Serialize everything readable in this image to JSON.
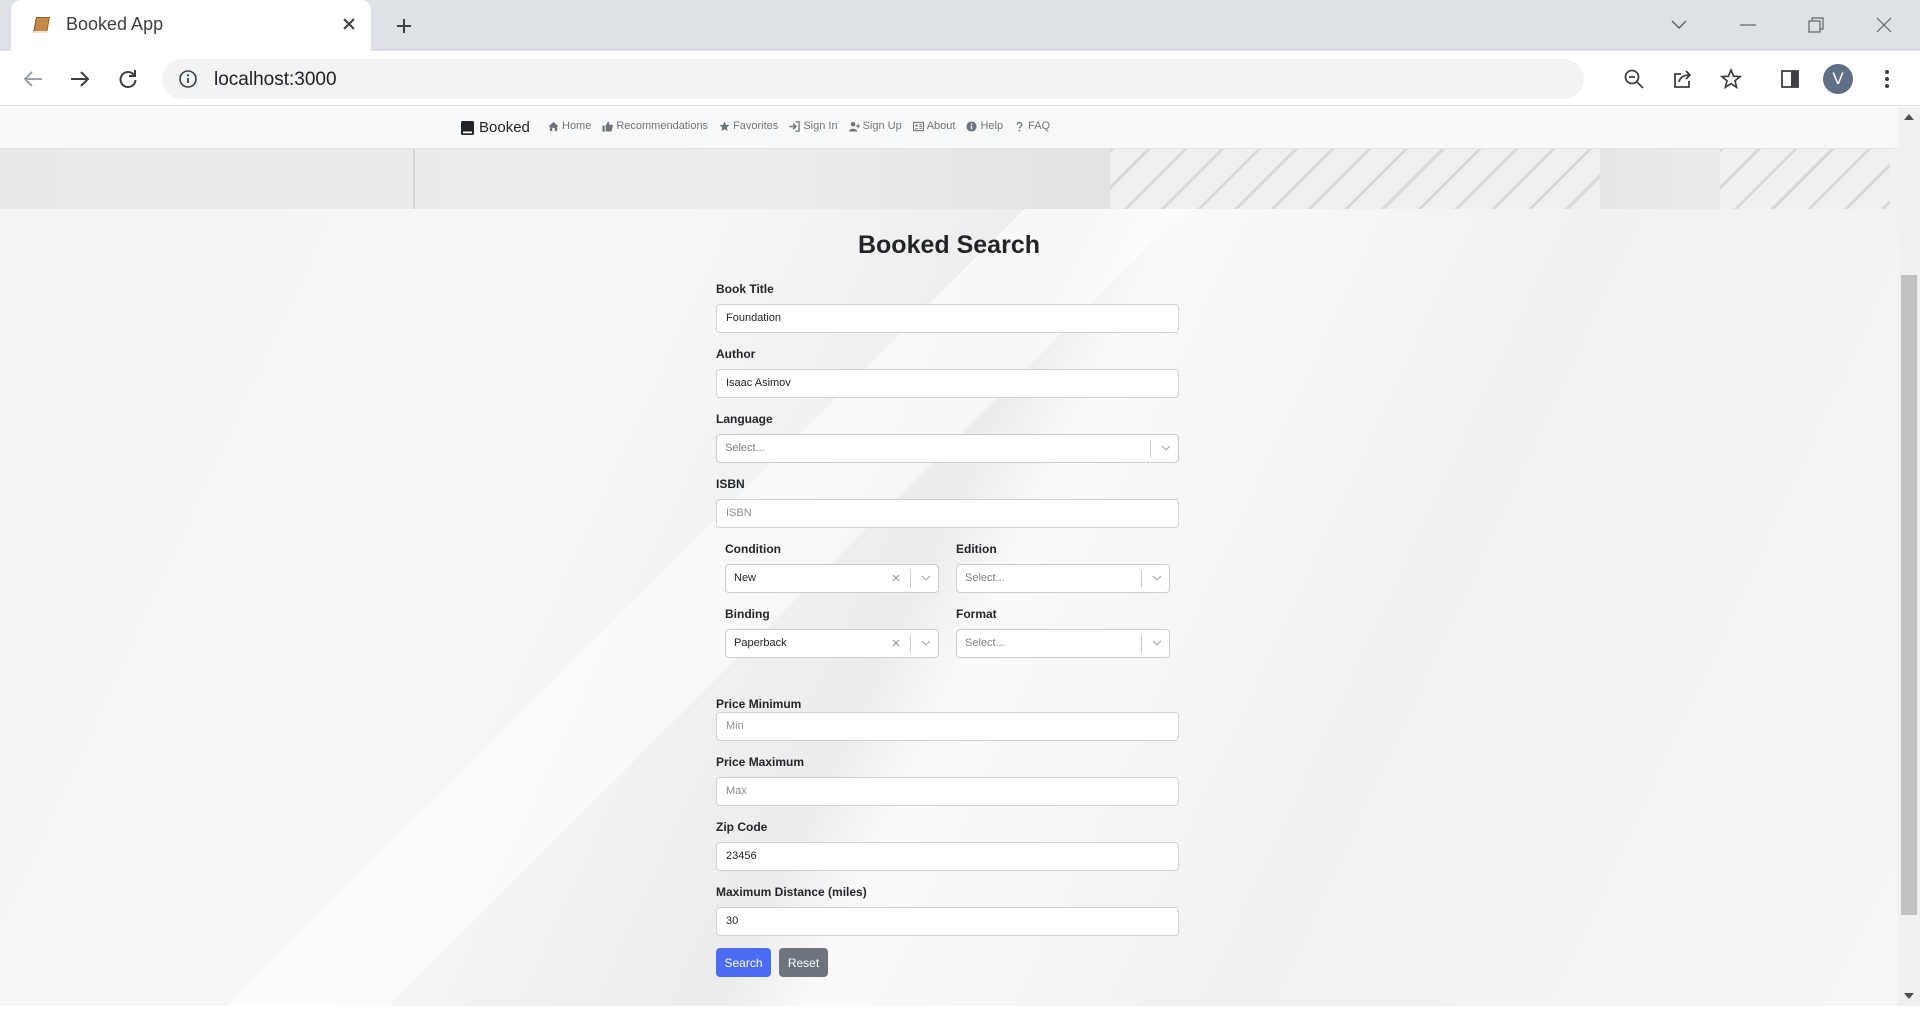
{
  "browser": {
    "tab_title": "Booked App",
    "url": "localhost:3000",
    "avatar_initial": "V"
  },
  "navbar": {
    "brand": "Booked",
    "links": [
      {
        "label": "Home",
        "icon": "home-icon"
      },
      {
        "label": "Recommendations",
        "icon": "thumbs-up-icon"
      },
      {
        "label": "Favorites",
        "icon": "star-icon"
      },
      {
        "label": "Sign In",
        "icon": "sign-in-icon"
      },
      {
        "label": "Sign Up",
        "icon": "user-plus-icon"
      },
      {
        "label": "About",
        "icon": "id-card-icon"
      },
      {
        "label": "Help",
        "icon": "info-circle-icon"
      },
      {
        "label": "FAQ",
        "icon": "question-icon"
      }
    ]
  },
  "form": {
    "title": "Booked Search",
    "book_title": {
      "label": "Book Title",
      "value": "Foundation"
    },
    "author": {
      "label": "Author",
      "value": "Isaac Asimov"
    },
    "language": {
      "label": "Language",
      "placeholder": "Select..."
    },
    "isbn": {
      "label": "ISBN",
      "placeholder": "ISBN"
    },
    "condition": {
      "label": "Condition",
      "value": "New"
    },
    "edition": {
      "label": "Edition",
      "placeholder": "Select..."
    },
    "binding": {
      "label": "Binding",
      "value": "Paperback"
    },
    "format": {
      "label": "Format",
      "placeholder": "Select..."
    },
    "price_min": {
      "label": "Price Minimum",
      "placeholder": "Min"
    },
    "price_max": {
      "label": "Price Maximum",
      "placeholder": "Max"
    },
    "zip": {
      "label": "Zip Code",
      "value": "23456"
    },
    "distance": {
      "label": "Maximum Distance (miles)",
      "value": "30"
    },
    "search_label": "Search",
    "reset_label": "Reset"
  },
  "colors": {
    "primary": "#4a6cf5",
    "secondary": "#6c757d"
  }
}
